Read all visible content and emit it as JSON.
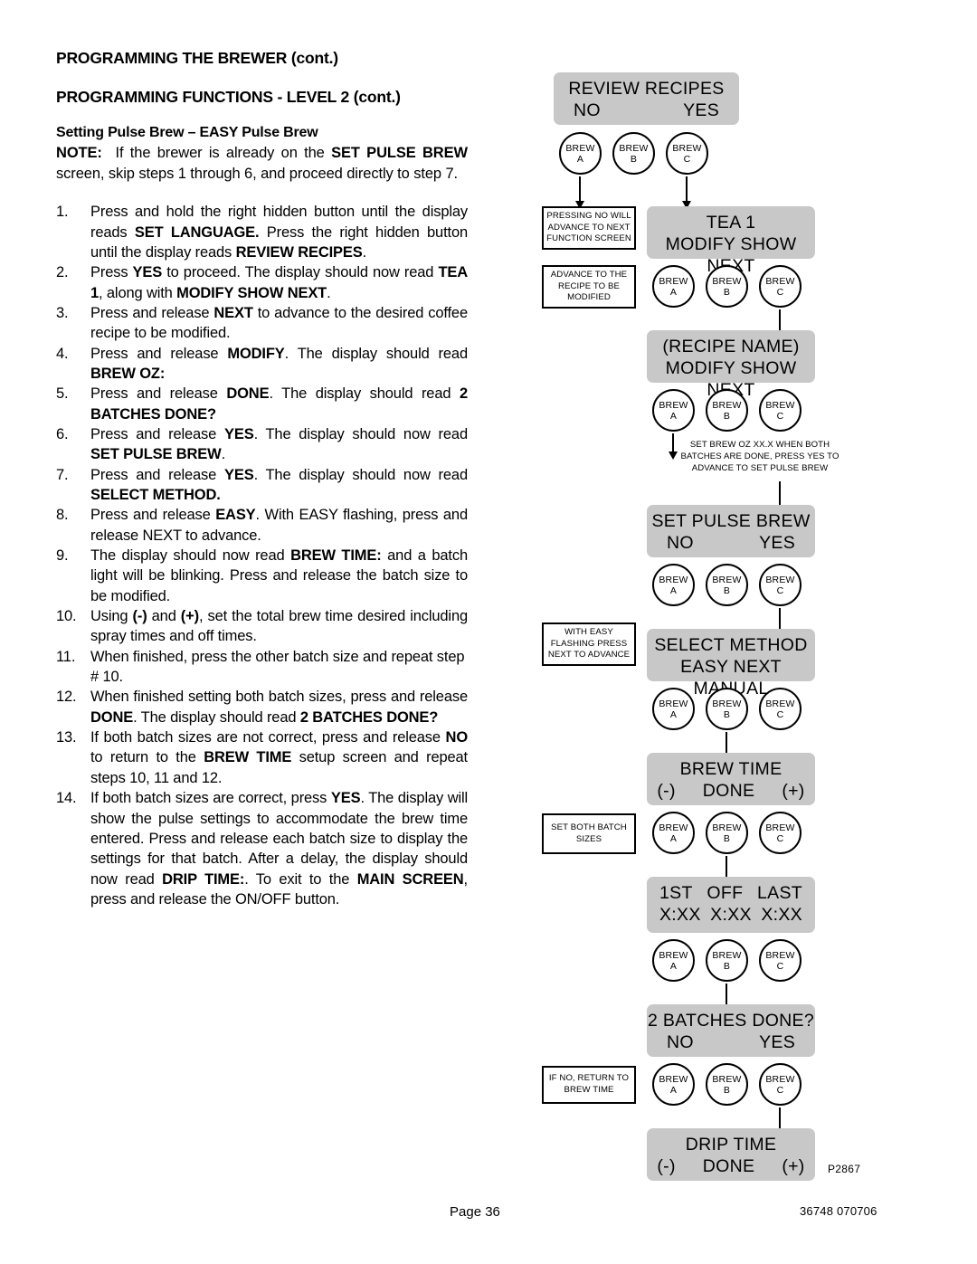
{
  "headings": {
    "h1": "PROGRAMMING THE BREWER (cont.)",
    "h2": "PROGRAMMING FUNCTIONS - LEVEL  2 (cont.)",
    "h3": "Setting Pulse Brew – EASY Pulse Brew"
  },
  "note": {
    "label": "NOTE:",
    "line1": "If the brewer is already on the ",
    "bold1": "SET PULSE BREW",
    "line2": " screen, skip steps 1 through 6, and proceed directly to step 7."
  },
  "steps": [
    {
      "num": "1.",
      "parts": [
        {
          "t": "Press and hold the right hidden button until the display reads ",
          "b": false
        },
        {
          "t": "SET LANGUAGE.",
          "b": true
        },
        {
          "t": " Press the right hidden button until the display reads ",
          "b": false
        },
        {
          "t": "REVIEW RECIPES",
          "b": true
        },
        {
          "t": ".",
          "b": false
        }
      ]
    },
    {
      "num": "2.",
      "parts": [
        {
          "t": "Press ",
          "b": false
        },
        {
          "t": "YES",
          "b": true
        },
        {
          "t": " to proceed. The display should now read ",
          "b": false
        },
        {
          "t": "TEA 1",
          "b": true
        },
        {
          "t": ", along with ",
          "b": false
        },
        {
          "t": "MODIFY SHOW NEXT",
          "b": true
        },
        {
          "t": ".",
          "b": false
        }
      ]
    },
    {
      "num": "3.",
      "parts": [
        {
          "t": "Press and release ",
          "b": false
        },
        {
          "t": "NEXT",
          "b": true
        },
        {
          "t": " to advance to the desired coffee recipe to be modified.",
          "b": false
        }
      ]
    },
    {
      "num": "4.",
      "parts": [
        {
          "t": "Press and release ",
          "b": false
        },
        {
          "t": "MODIFY",
          "b": true
        },
        {
          "t": ". The display should read ",
          "b": false
        },
        {
          "t": "BREW OZ:",
          "b": true
        }
      ]
    },
    {
      "num": "5.",
      "parts": [
        {
          "t": "Press and release ",
          "b": false
        },
        {
          "t": "DONE",
          "b": true
        },
        {
          "t": ".  The display should read ",
          "b": false
        },
        {
          "t": "2 BATCHES DONE?",
          "b": true
        }
      ]
    },
    {
      "num": "6.",
      "parts": [
        {
          "t": "Press and release ",
          "b": false
        },
        {
          "t": "YES",
          "b": true
        },
        {
          "t": ". The display should now read ",
          "b": false
        },
        {
          "t": "SET PULSE BREW",
          "b": true
        },
        {
          "t": ".",
          "b": false
        }
      ]
    },
    {
      "num": "7.",
      "parts": [
        {
          "t": "Press and release ",
          "b": false
        },
        {
          "t": "YES",
          "b": true
        },
        {
          "t": ". The display should now read ",
          "b": false
        },
        {
          "t": "SELECT METHOD.",
          "b": true
        }
      ]
    },
    {
      "num": "8.",
      "parts": [
        {
          "t": "Press and release ",
          "b": false
        },
        {
          "t": "EASY",
          "b": true
        },
        {
          "t": ". With EASY flashing, press and release NEXT to advance.",
          "b": false
        }
      ]
    },
    {
      "num": "9.",
      "parts": [
        {
          "t": "The display should now read ",
          "b": false
        },
        {
          "t": "BREW TIME:",
          "b": true
        },
        {
          "t": " and a batch light will be blinking.  Press and release the batch size to be modified.",
          "b": false
        }
      ]
    },
    {
      "num": "10.",
      "parts": [
        {
          "t": "Using ",
          "b": false
        },
        {
          "t": "(-)",
          "b": true
        },
        {
          "t": " and ",
          "b": false
        },
        {
          "t": "(+)",
          "b": true
        },
        {
          "t": ", set the total brew time desired including spray times and off times.",
          "b": false
        }
      ]
    },
    {
      "num": "11.",
      "parts": [
        {
          "t": "When finished, press the other batch size and repeat step # 10.",
          "b": false
        }
      ]
    },
    {
      "num": "12.",
      "parts": [
        {
          "t": "When finished setting both batch sizes, press and release ",
          "b": false
        },
        {
          "t": "DONE",
          "b": true
        },
        {
          "t": ".  The display should read ",
          "b": false
        },
        {
          "t": "2 BATCHES DONE?",
          "b": true
        }
      ]
    },
    {
      "num": "13.",
      "parts": [
        {
          "t": "If both batch sizes are not correct, press and release ",
          "b": false
        },
        {
          "t": "NO",
          "b": true
        },
        {
          "t": " to return to the ",
          "b": false
        },
        {
          "t": "BREW TIME",
          "b": true
        },
        {
          "t": " setup screen and repeat steps 10, 11 and 12.",
          "b": false
        }
      ]
    },
    {
      "num": "14.",
      "parts": [
        {
          "t": "If both batch sizes are correct, press ",
          "b": false
        },
        {
          "t": "YES",
          "b": true
        },
        {
          "t": ". The display will show the pulse settings to accommodate the brew time entered. Press and release each batch size to display the settings for that batch. After a delay, the display should now read ",
          "b": false
        },
        {
          "t": "DRIP TIME:",
          "b": true
        },
        {
          "t": ". To exit to the ",
          "b": false
        },
        {
          "t": "MAIN SCREEN",
          "b": true
        },
        {
          "t": ", press and release the ON/OFF button.",
          "b": false
        }
      ]
    }
  ],
  "flowchart": {
    "screens": {
      "review_recipes": {
        "line1": "REVIEW RECIPES",
        "left": "NO",
        "right": "YES"
      },
      "tea1": {
        "line1": "TEA 1",
        "line2": "MODIFY SHOW NEXT"
      },
      "recipe_name": {
        "line1": "(RECIPE NAME)",
        "line2": "MODIFY SHOW NEXT"
      },
      "set_pulse_brew": {
        "line1": "SET PULSE BREW",
        "left": "NO",
        "right": "YES"
      },
      "select_method": {
        "line1": "SELECT METHOD",
        "line2": "EASY NEXT MANUAL"
      },
      "brew_time": {
        "line1": "BREW TIME",
        "minus": "(-)",
        "done": "DONE",
        "plus": "(+)"
      },
      "first_off_last": {
        "c1_top": "1ST",
        "c2_top": "OFF",
        "c3_top": "LAST",
        "c1_bot": "X:XX",
        "c2_bot": "X:XX",
        "c3_bot": "X:XX"
      },
      "two_batches_done": {
        "line1": "2 BATCHES DONE?",
        "left": "NO",
        "right": "YES"
      },
      "drip_time": {
        "line1": "DRIP TIME",
        "minus": "(-)",
        "done": "DONE",
        "plus": "(+)"
      }
    },
    "brew_button": {
      "top": "BREW",
      "a": "A",
      "b": "B",
      "c": "C"
    },
    "callouts": {
      "pressing_no": "PRESSING NO WILL ADVANCE TO NEXT FUNCTION SCREEN",
      "advance_recipe": "ADVANCE TO THE RECIPE TO BE MODIFIED",
      "set_brew_oz": "SET BREW OZ  XX.X WHEN BOTH BATCHES ARE DONE, PRESS YES TO ADVANCE TO SET PULSE BREW",
      "easy_flashing": "WITH EASY FLASHING PRESS NEXT TO ADVANCE",
      "set_both": "SET BOTH BATCH SIZES",
      "if_no_return": "IF NO, RETURN TO BREW TIME"
    },
    "part_number": "P2867"
  },
  "footer": {
    "page": "Page 36",
    "code": "36748 070706"
  }
}
